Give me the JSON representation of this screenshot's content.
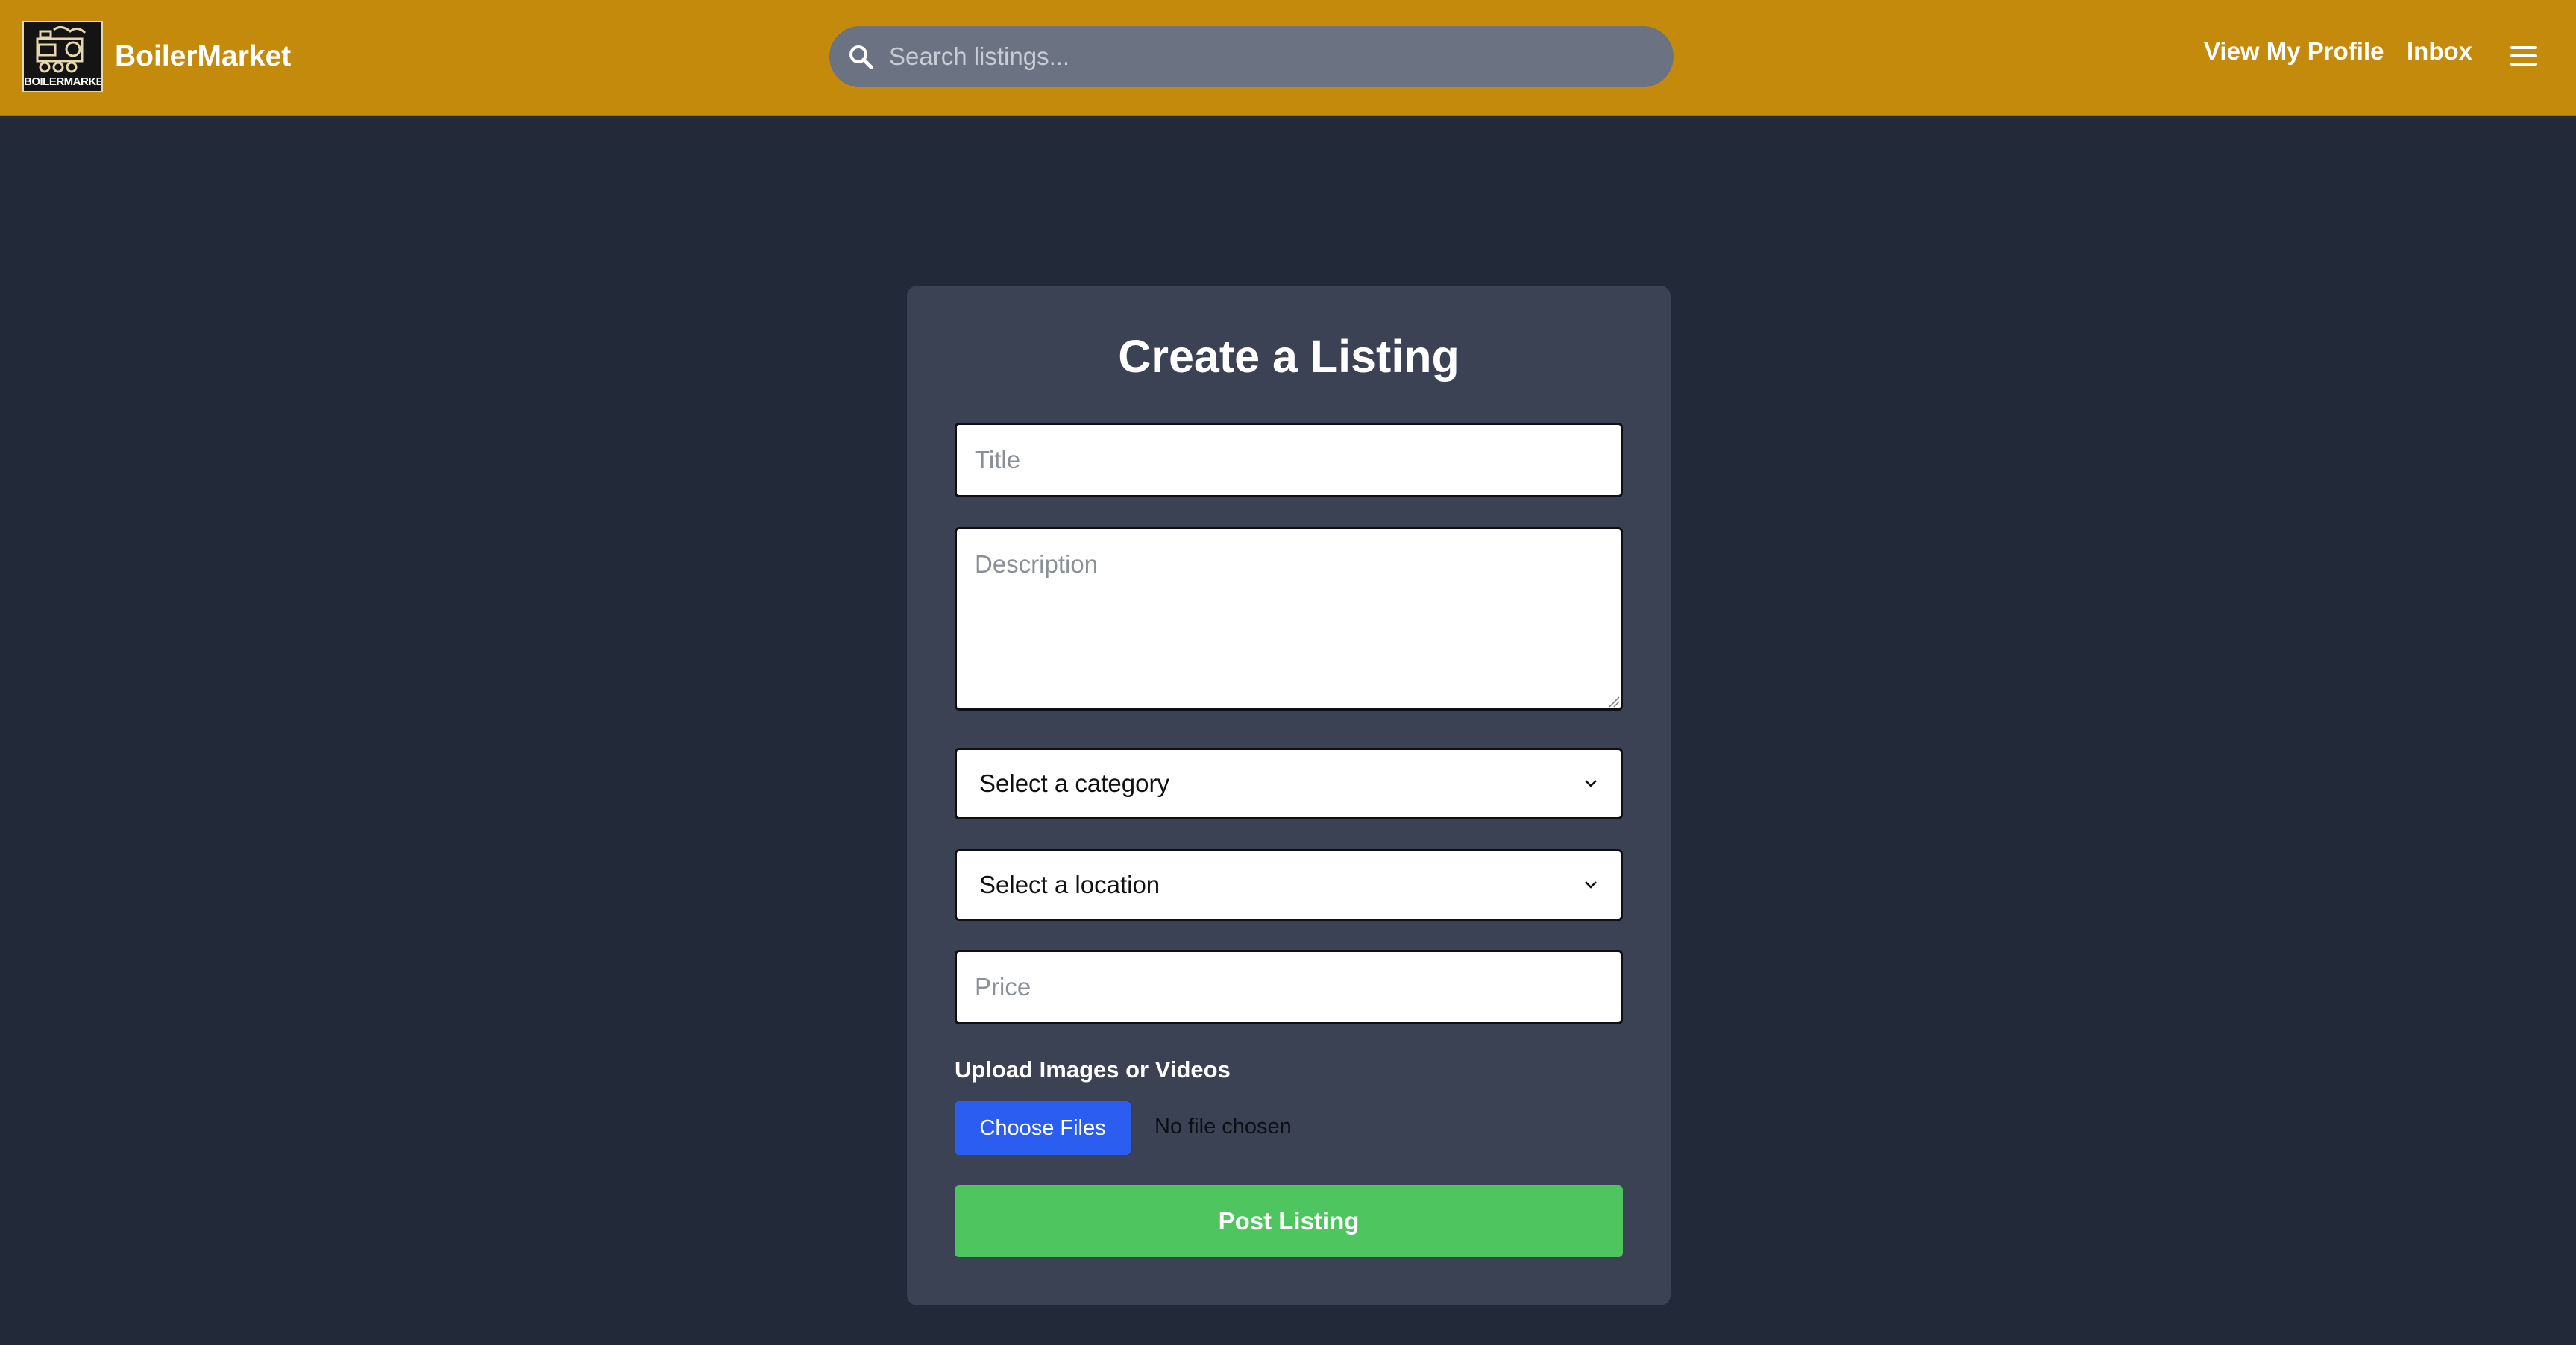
{
  "header": {
    "logo_text": "BOILERMARKET",
    "brand_name": "BoilerMarket",
    "search_placeholder": "Search listings...",
    "nav": {
      "profile": "View My Profile",
      "inbox": "Inbox"
    },
    "background_color": "#c48a0b"
  },
  "form": {
    "heading": "Create a Listing",
    "title_placeholder": "Title",
    "description_placeholder": "Description",
    "category_select": "Select a category",
    "location_select": "Select a location",
    "price_placeholder": "Price",
    "upload_label": "Upload Images or Videos",
    "choose_files_label": "Choose Files",
    "file_status": "No file chosen",
    "submit_label": "Post Listing"
  },
  "colors": {
    "page_bg": "#222a3a",
    "card_bg": "#3a4253",
    "choose_button": "#2b5ef0",
    "submit_button": "#4fc55f"
  }
}
